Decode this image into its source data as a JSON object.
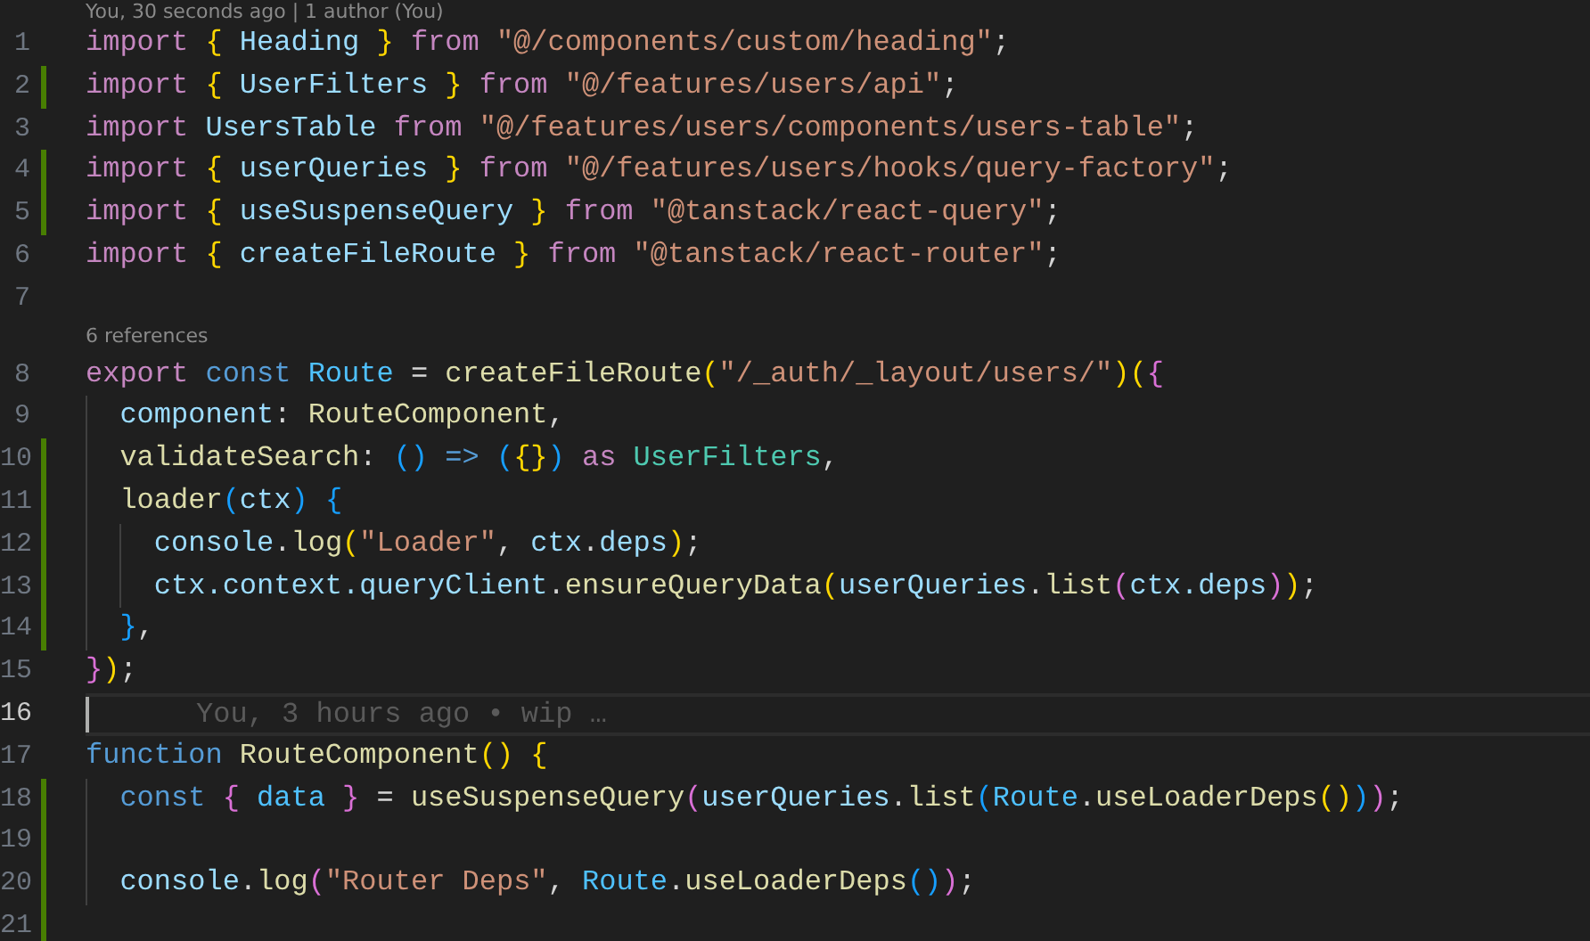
{
  "editor": {
    "lines": [
      {
        "kind": "codelens",
        "text": "You, 30 seconds ago | 1 author (You)"
      },
      {
        "kind": "code",
        "number": "1",
        "modified": false,
        "current": false,
        "tokens": [
          {
            "text": "import ",
            "kind": "k"
          },
          {
            "text": "{ ",
            "kind": "b1"
          },
          {
            "text": "Heading ",
            "kind": "v"
          },
          {
            "text": "} ",
            "kind": "b1"
          },
          {
            "text": "from ",
            "kind": "k"
          },
          {
            "text": "\"@/components/custom/heading\"",
            "kind": "str"
          },
          {
            "text": ";",
            "kind": "p"
          }
        ]
      },
      {
        "kind": "code",
        "number": "2",
        "modified": true,
        "current": false,
        "tokens": [
          {
            "text": "import ",
            "kind": "k"
          },
          {
            "text": "{ ",
            "kind": "b1"
          },
          {
            "text": "UserFilters ",
            "kind": "v"
          },
          {
            "text": "} ",
            "kind": "b1"
          },
          {
            "text": "from ",
            "kind": "k"
          },
          {
            "text": "\"@/features/users/api\"",
            "kind": "str"
          },
          {
            "text": ";",
            "kind": "p"
          }
        ]
      },
      {
        "kind": "code",
        "number": "3",
        "modified": false,
        "current": false,
        "tokens": [
          {
            "text": "import ",
            "kind": "k"
          },
          {
            "text": "UsersTable ",
            "kind": "v"
          },
          {
            "text": "from ",
            "kind": "k"
          },
          {
            "text": "\"@/features/users/components/users-table\"",
            "kind": "str"
          },
          {
            "text": ";",
            "kind": "p"
          }
        ]
      },
      {
        "kind": "code",
        "number": "4",
        "modified": true,
        "current": false,
        "tokens": [
          {
            "text": "import ",
            "kind": "k"
          },
          {
            "text": "{ ",
            "kind": "b1"
          },
          {
            "text": "userQueries ",
            "kind": "v"
          },
          {
            "text": "} ",
            "kind": "b1"
          },
          {
            "text": "from ",
            "kind": "k"
          },
          {
            "text": "\"@/features/users/hooks/query-factory\"",
            "kind": "str"
          },
          {
            "text": ";",
            "kind": "p"
          }
        ]
      },
      {
        "kind": "code",
        "number": "5",
        "modified": true,
        "current": false,
        "tokens": [
          {
            "text": "import ",
            "kind": "k"
          },
          {
            "text": "{ ",
            "kind": "b1"
          },
          {
            "text": "useSuspenseQuery ",
            "kind": "v"
          },
          {
            "text": "} ",
            "kind": "b1"
          },
          {
            "text": "from ",
            "kind": "k"
          },
          {
            "text": "\"@tanstack/react-query\"",
            "kind": "str"
          },
          {
            "text": ";",
            "kind": "p"
          }
        ]
      },
      {
        "kind": "code",
        "number": "6",
        "modified": false,
        "current": false,
        "tokens": [
          {
            "text": "import ",
            "kind": "k"
          },
          {
            "text": "{ ",
            "kind": "b1"
          },
          {
            "text": "createFileRoute ",
            "kind": "v"
          },
          {
            "text": "} ",
            "kind": "b1"
          },
          {
            "text": "from ",
            "kind": "k"
          },
          {
            "text": "\"@tanstack/react-router\"",
            "kind": "str"
          },
          {
            "text": ";",
            "kind": "p"
          }
        ]
      },
      {
        "kind": "code",
        "number": "7",
        "modified": false,
        "current": false
      },
      {
        "kind": "codelens",
        "text": "6 references"
      },
      {
        "kind": "code",
        "number": "8",
        "modified": false,
        "current": false,
        "tokens": [
          {
            "text": "export ",
            "kind": "k"
          },
          {
            "text": "const ",
            "kind": "s"
          },
          {
            "text": "Route ",
            "kind": "c"
          },
          {
            "text": "= ",
            "kind": "p"
          },
          {
            "text": "createFileRoute",
            "kind": "f"
          },
          {
            "text": "(",
            "kind": "b1"
          },
          {
            "text": "\"/_auth/_layout/users/\"",
            "kind": "str"
          },
          {
            "text": ")(",
            "kind": "b1"
          },
          {
            "text": "{",
            "kind": "b2"
          }
        ]
      },
      {
        "kind": "code",
        "number": "9",
        "modified": false,
        "current": false,
        "tokens": [
          {
            "text": "  component",
            "kind": "v"
          },
          {
            "text": ": ",
            "kind": "p"
          },
          {
            "text": "RouteComponent",
            "kind": "f"
          },
          {
            "text": ",",
            "kind": "p"
          }
        ]
      },
      {
        "kind": "code",
        "number": "10",
        "modified": true,
        "current": false,
        "tokens": [
          {
            "text": "  validateSearch",
            "kind": "f"
          },
          {
            "text": ": ",
            "kind": "p"
          },
          {
            "text": "() ",
            "kind": "b3"
          },
          {
            "text": "=> ",
            "kind": "s"
          },
          {
            "text": "(",
            "kind": "b3"
          },
          {
            "text": "{}",
            "kind": "b1"
          },
          {
            "text": ") ",
            "kind": "b3"
          },
          {
            "text": "as ",
            "kind": "k"
          },
          {
            "text": "UserFilters",
            "kind": "t"
          },
          {
            "text": ",",
            "kind": "p"
          }
        ]
      },
      {
        "kind": "code",
        "number": "11",
        "modified": true,
        "current": false,
        "tokens": [
          {
            "text": "  loader",
            "kind": "f"
          },
          {
            "text": "(",
            "kind": "b3"
          },
          {
            "text": "ctx",
            "kind": "v"
          },
          {
            "text": ") ",
            "kind": "b3"
          },
          {
            "text": "{",
            "kind": "b3"
          }
        ]
      },
      {
        "kind": "code",
        "number": "12",
        "modified": true,
        "current": false,
        "tokens": [
          {
            "text": "    console",
            "kind": "v"
          },
          {
            "text": ".",
            "kind": "p"
          },
          {
            "text": "log",
            "kind": "f"
          },
          {
            "text": "(",
            "kind": "b1"
          },
          {
            "text": "\"Loader\"",
            "kind": "str"
          },
          {
            "text": ", ",
            "kind": "p"
          },
          {
            "text": "ctx",
            "kind": "v"
          },
          {
            "text": ".",
            "kind": "p"
          },
          {
            "text": "deps",
            "kind": "v"
          },
          {
            "text": ")",
            "kind": "b1"
          },
          {
            "text": ";",
            "kind": "p"
          }
        ]
      },
      {
        "kind": "code",
        "number": "13",
        "modified": true,
        "current": false,
        "tokens": [
          {
            "text": "    ctx.context.queryClient",
            "kind": "v"
          },
          {
            "text": ".",
            "kind": "p"
          },
          {
            "text": "ensureQueryData",
            "kind": "f"
          },
          {
            "text": "(",
            "kind": "b1"
          },
          {
            "text": "userQueries",
            "kind": "v"
          },
          {
            "text": ".",
            "kind": "p"
          },
          {
            "text": "list",
            "kind": "f"
          },
          {
            "text": "(",
            "kind": "b2"
          },
          {
            "text": "ctx.deps",
            "kind": "v"
          },
          {
            "text": ")",
            "kind": "b2"
          },
          {
            "text": ")",
            "kind": "b1"
          },
          {
            "text": ";",
            "kind": "p"
          }
        ]
      },
      {
        "kind": "code",
        "number": "14",
        "modified": true,
        "current": false,
        "tokens": [
          {
            "text": "  }",
            "kind": "b3"
          },
          {
            "text": ",",
            "kind": "p"
          }
        ]
      },
      {
        "kind": "code",
        "number": "15",
        "modified": false,
        "current": false,
        "tokens": [
          {
            "text": "}",
            "kind": "b2"
          },
          {
            "text": ")",
            "kind": "b1"
          },
          {
            "text": ";",
            "kind": "p"
          }
        ]
      },
      {
        "kind": "code",
        "number": "16",
        "modified": false,
        "current": true,
        "blame": "You, 3 hours ago • wip …"
      },
      {
        "kind": "code",
        "number": "17",
        "modified": false,
        "current": false,
        "tokens": [
          {
            "text": "function ",
            "kind": "s"
          },
          {
            "text": "RouteComponent",
            "kind": "f"
          },
          {
            "text": "() {",
            "kind": "b1"
          }
        ]
      },
      {
        "kind": "code",
        "number": "18",
        "modified": true,
        "current": false,
        "tokens": [
          {
            "text": "  const ",
            "kind": "s"
          },
          {
            "text": "{ ",
            "kind": "b2"
          },
          {
            "text": "data ",
            "kind": "c"
          },
          {
            "text": "} ",
            "kind": "b2"
          },
          {
            "text": "= ",
            "kind": "p"
          },
          {
            "text": "useSuspenseQuery",
            "kind": "f"
          },
          {
            "text": "(",
            "kind": "b2"
          },
          {
            "text": "userQueries",
            "kind": "v"
          },
          {
            "text": ".",
            "kind": "p"
          },
          {
            "text": "list",
            "kind": "f"
          },
          {
            "text": "(",
            "kind": "b3"
          },
          {
            "text": "Route",
            "kind": "c"
          },
          {
            "text": ".",
            "kind": "p"
          },
          {
            "text": "useLoaderDeps",
            "kind": "f"
          },
          {
            "text": "()",
            "kind": "b1"
          },
          {
            "text": ")",
            "kind": "b3"
          },
          {
            "text": ")",
            "kind": "b2"
          },
          {
            "text": ";",
            "kind": "p"
          }
        ]
      },
      {
        "kind": "code",
        "number": "19",
        "modified": true,
        "current": false
      },
      {
        "kind": "code",
        "number": "20",
        "modified": true,
        "current": false,
        "tokens": [
          {
            "text": "  console",
            "kind": "v"
          },
          {
            "text": ".",
            "kind": "p"
          },
          {
            "text": "log",
            "kind": "f"
          },
          {
            "text": "(",
            "kind": "b2"
          },
          {
            "text": "\"Router Deps\"",
            "kind": "str"
          },
          {
            "text": ", ",
            "kind": "p"
          },
          {
            "text": "Route",
            "kind": "c"
          },
          {
            "text": ".",
            "kind": "p"
          },
          {
            "text": "useLoaderDeps",
            "kind": "f"
          },
          {
            "text": "()",
            "kind": "b3"
          },
          {
            "text": ")",
            "kind": "b2"
          },
          {
            "text": ";",
            "kind": "p"
          }
        ]
      },
      {
        "kind": "code",
        "number": "21",
        "modified": true,
        "current": false
      }
    ]
  }
}
